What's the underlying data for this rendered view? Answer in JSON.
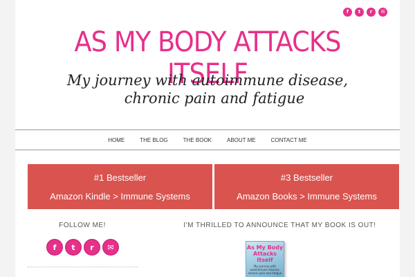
{
  "social_top": [
    {
      "name": "facebook",
      "glyph": "f"
    },
    {
      "name": "twitter",
      "glyph": "t"
    },
    {
      "name": "rss",
      "glyph": "r"
    },
    {
      "name": "email",
      "glyph": "✉"
    }
  ],
  "header": {
    "title": "AS MY BODY ATTACKS ITSELF",
    "tagline_1": "My journey with autoimmune disease,",
    "tagline_2": "chronic pain and fatigue"
  },
  "nav": [
    "HOME",
    "THE BLOG",
    "THE BOOK",
    "ABOUT ME",
    "CONTACT ME"
  ],
  "bestsellers": [
    {
      "line1": "#1 Bestseller",
      "line2": "Amazon Kindle > Immune Systems"
    },
    {
      "line1": "#3 Bestseller",
      "line2": "Amazon Books > Immune Systems"
    }
  ],
  "follow": {
    "title": "FOLLOW ME!",
    "icons": [
      {
        "name": "facebook",
        "glyph": "f"
      },
      {
        "name": "twitter",
        "glyph": "t"
      },
      {
        "name": "rss",
        "glyph": "r"
      },
      {
        "name": "email",
        "glyph": "✉"
      }
    ]
  },
  "announce": {
    "title": "I'M THRILLED TO ANNOUNCE THAT MY BOOK IS OUT!",
    "book_title": "As My Body Attacks Itself",
    "book_subtitle": "My journey with autoimmune disease, chronic pain and fatigue"
  },
  "colors": {
    "accent": "#e6308a",
    "banner": "#d9534f"
  }
}
